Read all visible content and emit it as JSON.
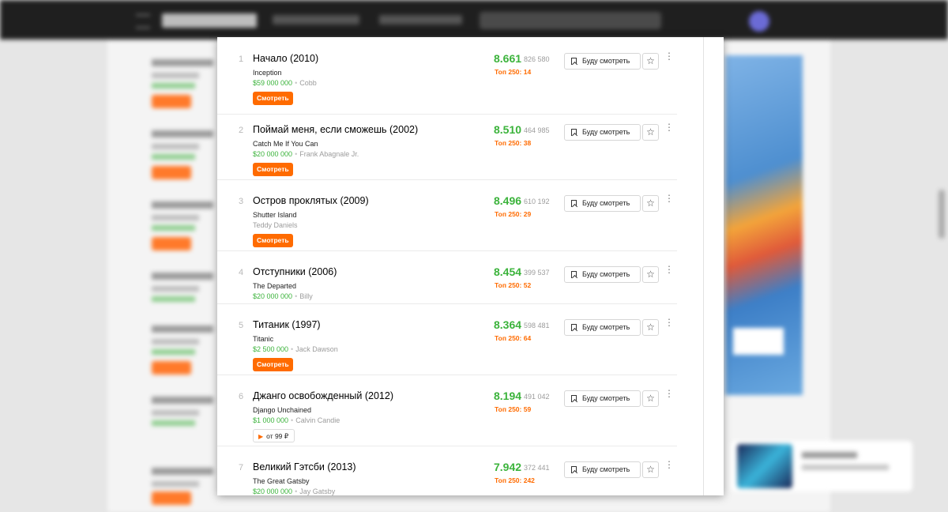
{
  "films": [
    {
      "rank": "1",
      "title": "Начало (2010)",
      "original": "Inception",
      "budget": "$59 000 000",
      "role": "Cobb",
      "rating": "8.661",
      "votes": "826 580",
      "top250": "Топ 250: 14",
      "action": "Смотреть"
    },
    {
      "rank": "2",
      "title": "Поймай меня, если сможешь (2002)",
      "original": "Catch Me If You Can",
      "budget": "$20 000 000",
      "role": "Frank Abagnale Jr.",
      "rating": "8.510",
      "votes": "464 985",
      "top250": "Топ 250: 38",
      "action": "Смотреть"
    },
    {
      "rank": "3",
      "title": "Остров проклятых (2009)",
      "original": "Shutter Island",
      "budget": "",
      "role": "Teddy Daniels",
      "rating": "8.496",
      "votes": "610 192",
      "top250": "Топ 250: 29",
      "action": "Смотреть"
    },
    {
      "rank": "4",
      "title": "Отступники (2006)",
      "original": "The Departed",
      "budget": "$20 000 000",
      "role": "Billy",
      "rating": "8.454",
      "votes": "399 537",
      "top250": "Топ 250: 52",
      "action": ""
    },
    {
      "rank": "5",
      "title": "Титаник (1997)",
      "original": "Titanic",
      "budget": "$2 500 000",
      "role": "Jack Dawson",
      "rating": "8.364",
      "votes": "598 481",
      "top250": "Топ 250: 64",
      "action": "Смотреть"
    },
    {
      "rank": "6",
      "title": "Джанго освобожденный (2012)",
      "original": "Django Unchained",
      "budget": "$1 000 000",
      "role": "Calvin Candie",
      "rating": "8.194",
      "votes": "491 042",
      "top250": "Топ 250: 59",
      "price": "от 99 ₽"
    },
    {
      "rank": "7",
      "title": "Великий Гэтсби (2013)",
      "original": "The Great Gatsby",
      "budget": "$20 000 000",
      "role": "Jay Gatsby",
      "rating": "7.942",
      "votes": "372 441",
      "top250": "Топ 250: 242",
      "action": ""
    }
  ],
  "labels": {
    "want_to_watch": "Буду смотреть",
    "star_icon": "☆",
    "more_icon": "⋮",
    "separator": "•",
    "play_icon": "▶"
  },
  "colors": {
    "rating_green": "#3bb33b",
    "accent_orange": "#ff6b00"
  }
}
